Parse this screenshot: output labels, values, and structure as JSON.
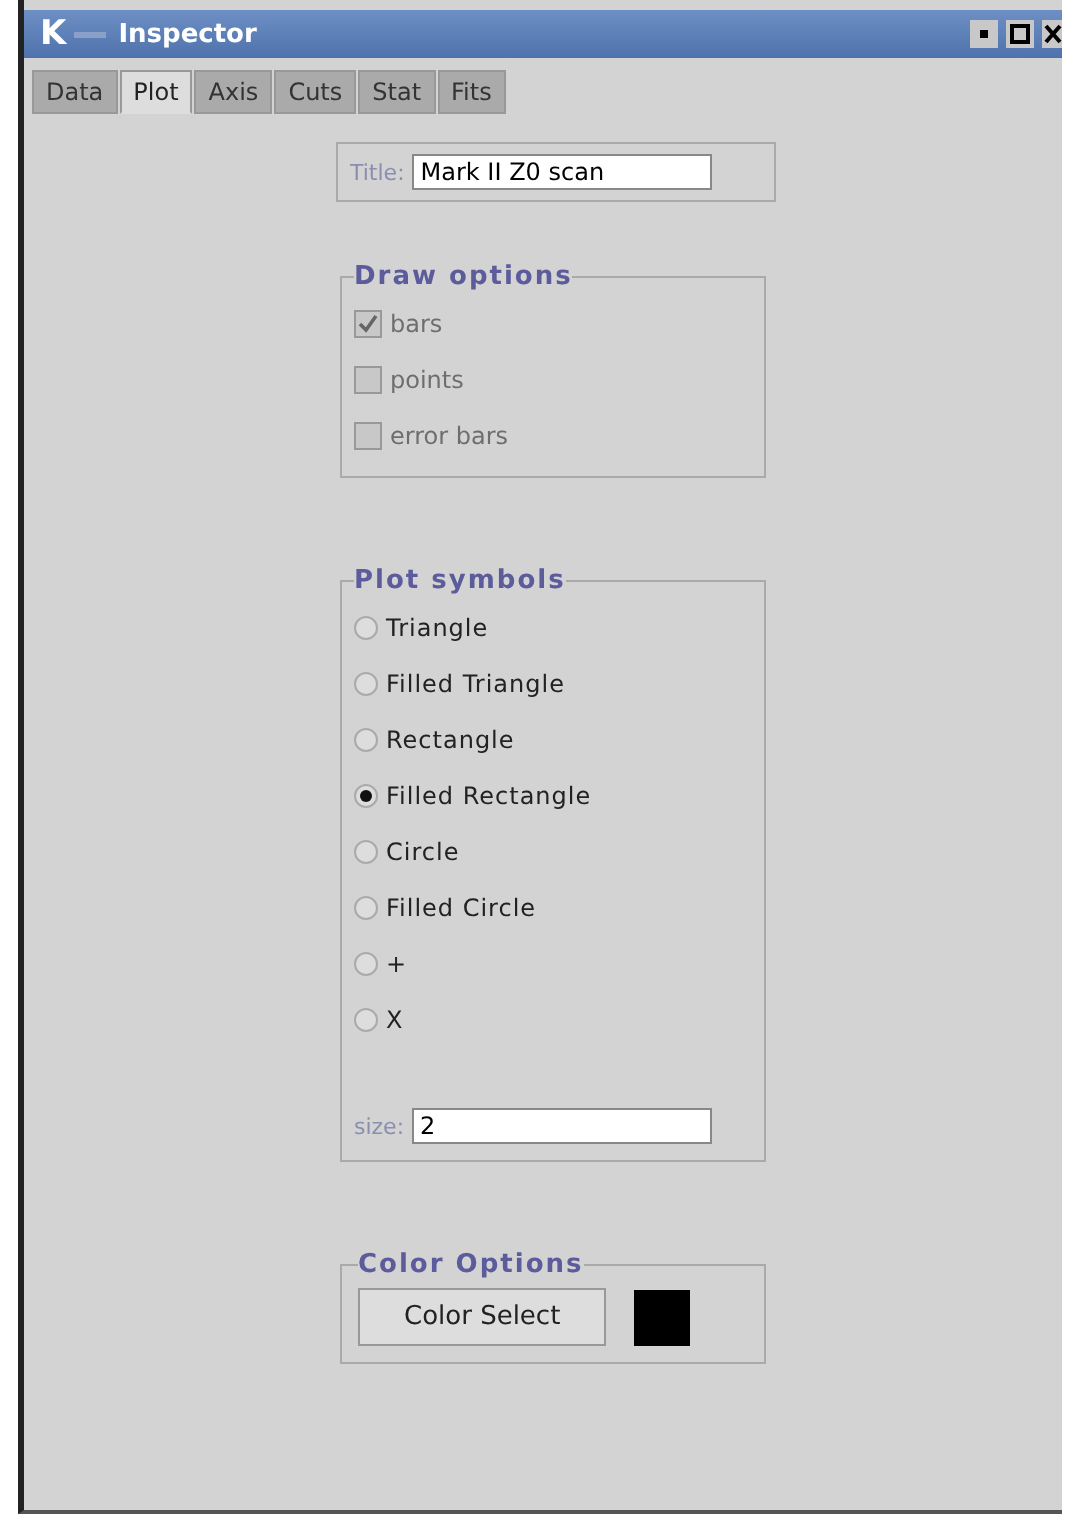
{
  "window": {
    "title": "Inspector",
    "logo": "K"
  },
  "tabs": [
    {
      "label": "Data",
      "selected": false
    },
    {
      "label": "Plot",
      "selected": true
    },
    {
      "label": "Axis",
      "selected": false
    },
    {
      "label": "Cuts",
      "selected": false
    },
    {
      "label": "Stat",
      "selected": false
    },
    {
      "label": "Fits",
      "selected": false
    }
  ],
  "title_field": {
    "label": "Title:",
    "value": "Mark II Z0 scan"
  },
  "draw_options": {
    "title": "Draw options",
    "items": [
      {
        "label": "bars",
        "checked": true,
        "disabled": true
      },
      {
        "label": "points",
        "checked": false,
        "disabled": true
      },
      {
        "label": "error bars",
        "checked": false,
        "disabled": true
      }
    ]
  },
  "plot_symbols": {
    "title": "Plot symbols",
    "options": [
      {
        "label": "Triangle",
        "selected": false
      },
      {
        "label": "Filled Triangle",
        "selected": false
      },
      {
        "label": "Rectangle",
        "selected": false
      },
      {
        "label": "Filled Rectangle",
        "selected": true
      },
      {
        "label": "Circle",
        "selected": false
      },
      {
        "label": "Filled Circle",
        "selected": false
      },
      {
        "label": "+",
        "selected": false
      },
      {
        "label": "X",
        "selected": false
      }
    ],
    "size_label": "size:",
    "size_value": "2"
  },
  "color_options": {
    "title": "Color Options",
    "button": "Color Select"
  }
}
